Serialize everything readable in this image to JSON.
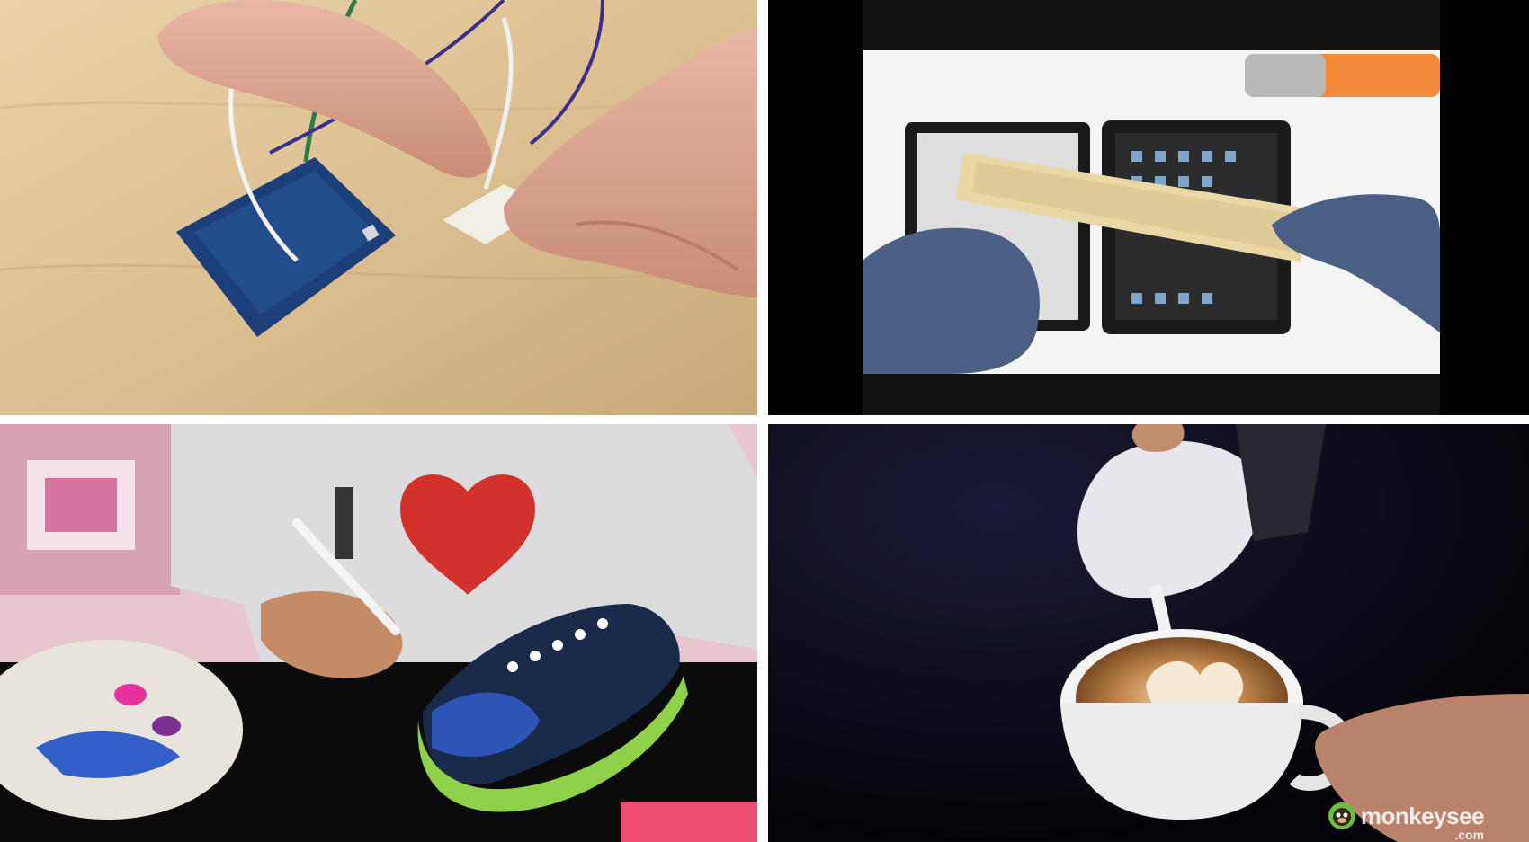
{
  "tiles": [
    {
      "subject": "arduino-breadboard-wiring"
    },
    {
      "subject": "tablet-screen-adhesive-repair"
    },
    {
      "subject": "painting-canvas-sneaker"
    },
    {
      "subject": "latte-art-pour"
    }
  ],
  "watermark": {
    "word": "monkeysee",
    "sub": ".com"
  },
  "colors": {
    "gap": "#ffffff",
    "video_bar": "#000000"
  }
}
